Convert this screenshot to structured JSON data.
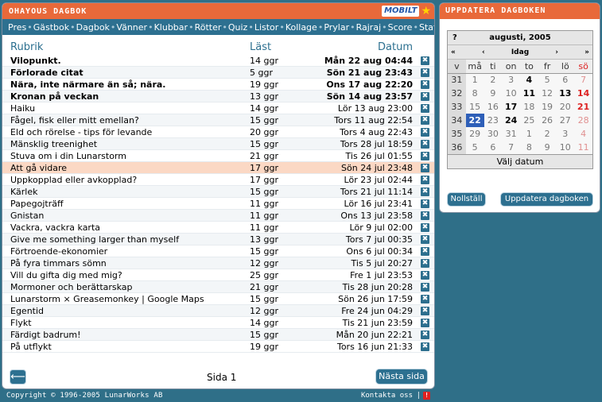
{
  "main": {
    "title": "OHAYOUS DAGBOK",
    "brand": "MOBILT",
    "nav": [
      "Pres",
      "Gästbok",
      "Dagbok",
      "Vänner",
      "Klubbar",
      "Rötter",
      "Quiz",
      "Listor",
      "Kollage",
      "Prylar",
      "Rajraj",
      "Score",
      "Status"
    ],
    "columns": {
      "title": "Rubrik",
      "read": "Läst",
      "date": "Datum"
    },
    "entries": [
      {
        "title": "Vilopunkt.",
        "read": "14 ggr",
        "date": "Mån 22 aug 04:44",
        "bold": true
      },
      {
        "title": "Förlorade citat",
        "read": "5 ggr",
        "date": "Sön 21 aug 23:43",
        "bold": true
      },
      {
        "title": "Nära, inte närmare än så; nära.",
        "read": "19 ggr",
        "date": "Ons 17 aug 22:20",
        "bold": true
      },
      {
        "title": "Kronan på veckan",
        "read": "13 ggr",
        "date": "Sön 14 aug 23:57",
        "bold": true
      },
      {
        "title": "Haiku",
        "read": "14 ggr",
        "date": "Lör 13 aug 23:00"
      },
      {
        "title": "Fågel, fisk eller mitt emellan?",
        "read": "15 ggr",
        "date": "Tors 11 aug 22:54"
      },
      {
        "title": "Eld och rörelse - tips för levande",
        "read": "20 ggr",
        "date": "Tors 4 aug 22:43"
      },
      {
        "title": "Mänsklig treenighet",
        "read": "15 ggr",
        "date": "Tors 28 jul 18:59"
      },
      {
        "title": "Stuva om i din Lunarstorm",
        "read": "21 ggr",
        "date": "Tis 26 jul 01:55"
      },
      {
        "title": "Att gå vidare",
        "read": "17 ggr",
        "date": "Sön 24 jul 23:48",
        "highlight": true
      },
      {
        "title": "Uppkopplad eller avkopplad?",
        "read": "17 ggr",
        "date": "Lör 23 jul 02:44"
      },
      {
        "title": "Kärlek",
        "read": "15 ggr",
        "date": "Tors 21 jul 11:14"
      },
      {
        "title": "Papegojträff",
        "read": "11 ggr",
        "date": "Lör 16 jul 23:41"
      },
      {
        "title": "Gnistan",
        "read": "11 ggr",
        "date": "Ons 13 jul 23:58"
      },
      {
        "title": "Vackra, vackra karta",
        "read": "11 ggr",
        "date": "Lör 9 jul 02:00"
      },
      {
        "title": "Give me something larger than myself",
        "read": "13 ggr",
        "date": "Tors 7 jul 00:35"
      },
      {
        "title": "Förtroende-ekonomier",
        "read": "15 ggr",
        "date": "Ons 6 jul 00:34"
      },
      {
        "title": "På fyra timmars sömn",
        "read": "12 ggr",
        "date": "Tis 5 jul 20:27"
      },
      {
        "title": "Vill du gifta dig med mig?",
        "read": "25 ggr",
        "date": "Fre 1 jul 23:53"
      },
      {
        "title": "Mormoner och berättarskap",
        "read": "21 ggr",
        "date": "Tis 28 jun 20:28"
      },
      {
        "title": "Lunarstorm × Greasemonkey | Google Maps",
        "read": "15 ggr",
        "date": "Sön 26 jun 17:59"
      },
      {
        "title": "Egentid",
        "read": "12 ggr",
        "date": "Fre 24 jun 04:29"
      },
      {
        "title": "Flykt",
        "read": "14 ggr",
        "date": "Tis 21 jun 23:59"
      },
      {
        "title": "Färdigt badrum!",
        "read": "15 ggr",
        "date": "Mån 20 jun 22:21"
      },
      {
        "title": "På utflykt",
        "read": "19 ggr",
        "date": "Tors 16 jun 21:33"
      }
    ],
    "delete_glyph": "✖",
    "back_glyph": "⟵",
    "page_label": "Sida 1",
    "next_label": "Nästa sida"
  },
  "footer": {
    "copyright": "Copyright © 1996-2005 LunarWorks AB",
    "contact": "Kontakta oss",
    "separator": "|",
    "alert_glyph": "!"
  },
  "side": {
    "title": "UPPDATERA DAGBOKEN",
    "calendar": {
      "help": "?",
      "month": "augusti, 2005",
      "nav": {
        "prev_year": "«",
        "prev_month": "‹",
        "today": "Idag",
        "next_month": "›",
        "next_year": "»"
      },
      "headers": [
        "v",
        "må",
        "ti",
        "on",
        "to",
        "fr",
        "lö",
        "sö"
      ],
      "weeks": [
        {
          "wk": "31",
          "days": [
            {
              "d": "1"
            },
            {
              "d": "2"
            },
            {
              "d": "3"
            },
            {
              "d": "4",
              "cur": true
            },
            {
              "d": "5"
            },
            {
              "d": "6"
            },
            {
              "d": "7"
            }
          ]
        },
        {
          "wk": "32",
          "days": [
            {
              "d": "8"
            },
            {
              "d": "9"
            },
            {
              "d": "10"
            },
            {
              "d": "11",
              "cur": true
            },
            {
              "d": "12"
            },
            {
              "d": "13",
              "cur": true
            },
            {
              "d": "14",
              "cur": true
            }
          ]
        },
        {
          "wk": "33",
          "days": [
            {
              "d": "15"
            },
            {
              "d": "16"
            },
            {
              "d": "17",
              "cur": true
            },
            {
              "d": "18"
            },
            {
              "d": "19"
            },
            {
              "d": "20"
            },
            {
              "d": "21",
              "cur": true
            }
          ]
        },
        {
          "wk": "34",
          "days": [
            {
              "d": "22",
              "today": true
            },
            {
              "d": "23"
            },
            {
              "d": "24",
              "cur": true
            },
            {
              "d": "25"
            },
            {
              "d": "26"
            },
            {
              "d": "27"
            },
            {
              "d": "28"
            }
          ]
        },
        {
          "wk": "35",
          "days": [
            {
              "d": "29"
            },
            {
              "d": "30"
            },
            {
              "d": "31"
            },
            {
              "d": "1"
            },
            {
              "d": "2"
            },
            {
              "d": "3"
            },
            {
              "d": "4"
            }
          ]
        },
        {
          "wk": "36",
          "days": [
            {
              "d": "5"
            },
            {
              "d": "6"
            },
            {
              "d": "7"
            },
            {
              "d": "8"
            },
            {
              "d": "9"
            },
            {
              "d": "10"
            },
            {
              "d": "11"
            }
          ]
        }
      ],
      "footer": "Välj datum"
    },
    "reset_label": "Nollställ",
    "update_label": "Uppdatera dagboken"
  },
  "colors": {
    "header": "#e8693a",
    "nav": "#2d7090",
    "background": "#2f6f88",
    "highlight": "#fbd8c4",
    "today": "#2e5fb8"
  }
}
